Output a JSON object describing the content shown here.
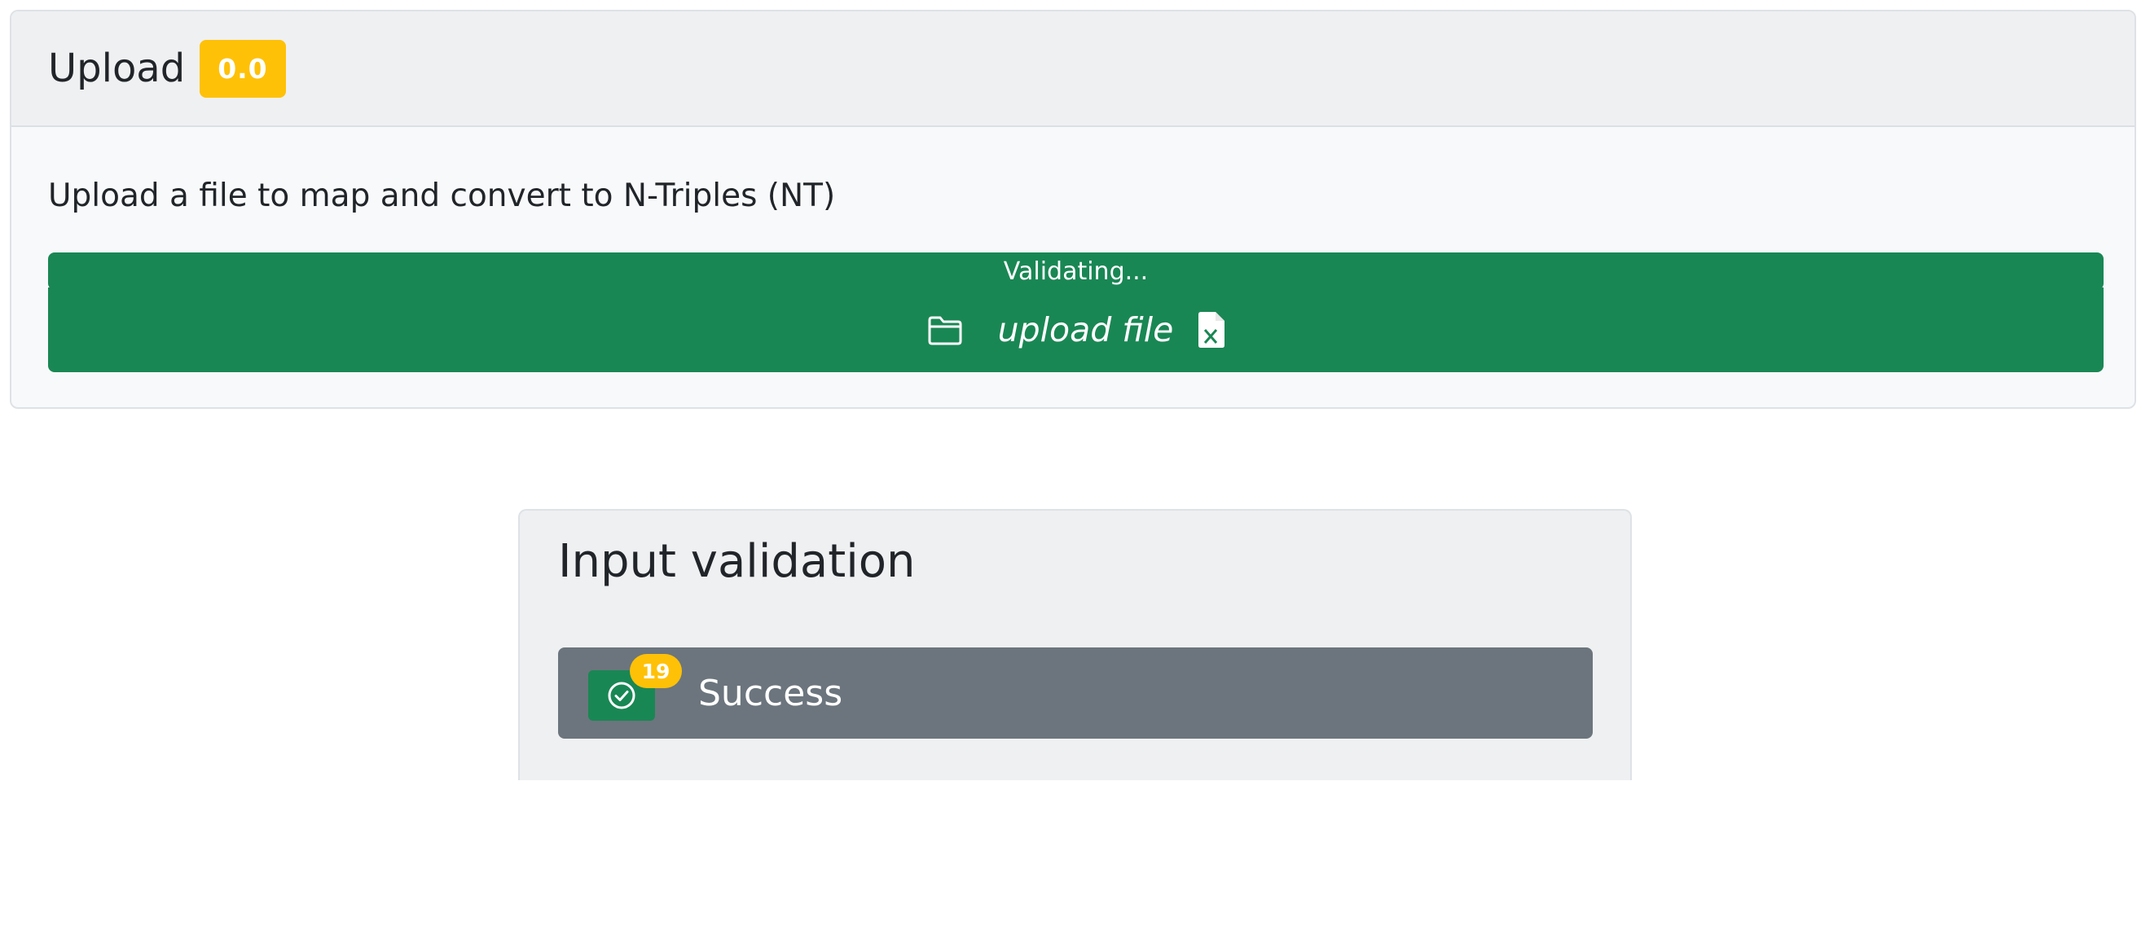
{
  "upload_card": {
    "title": "Upload",
    "version_badge": "0.0",
    "description": "Upload a file to map and convert to N-Triples (NT)",
    "progress_text": "Validating...",
    "upload_button_label": "upload file",
    "icons": [
      "folder-icon",
      "excel-file-icon"
    ]
  },
  "validation_card": {
    "title": "Input validation",
    "items": [
      {
        "status": "Success",
        "count": "19",
        "icon": "check-circle-icon"
      }
    ]
  },
  "colors": {
    "success_green": "#198754",
    "warning_yellow": "#ffc107",
    "secondary_gray": "#6c757d",
    "card_header_bg": "#eff0f2",
    "card_body_bg": "#f8f9fa"
  }
}
